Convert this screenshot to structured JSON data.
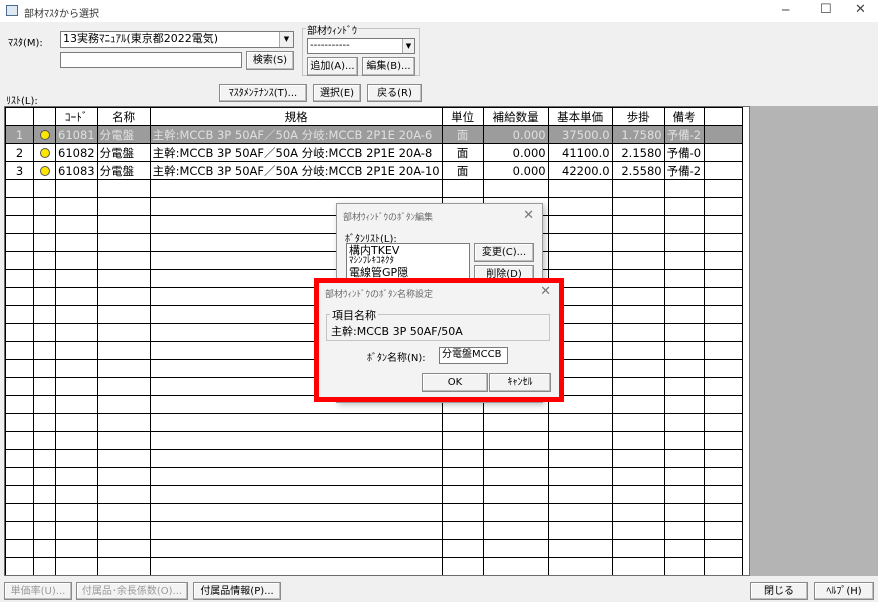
{
  "window": {
    "title": "部材ﾏｽﾀから選択",
    "app_icon": "window-icon",
    "controls": [
      "minimize-icon",
      "maximize-icon",
      "close-icon"
    ]
  },
  "master": {
    "label": "ﾏｽﾀ(M):",
    "selected": "13実務ﾏﾆｭｱﾙ(東京都2022電気)",
    "search_value": "",
    "search_button": "検索(S)"
  },
  "buhin_window": {
    "group_label": "部材ｳｨﾝﾄﾞｳ",
    "selected": "-----------",
    "add_button": "追加(A)...",
    "edit_button": "編集(B)..."
  },
  "list_label": "ﾘｽﾄ(L):",
  "toolbar": {
    "maint_button": "ﾏｽﾀﾒﾝﾃﾅﾝｽ(T)...",
    "select_button": "選択(E)",
    "back_button": "戻る(R)"
  },
  "table": {
    "headers": [
      "",
      "",
      "ｺｰﾄﾞ",
      "名称",
      "規格",
      "単位",
      "補給数量",
      "基本単価",
      "歩掛",
      "備考"
    ],
    "rows": [
      {
        "no": "1",
        "code": "61081",
        "name": "分電盤",
        "spec": "主幹:MCCB 3P 50AF／50A 分岐:MCCB 2P1E 20A-6",
        "unit": "面",
        "qty": "0.000",
        "price": "37500.0",
        "rate": "1.7580",
        "note": "予備-2"
      },
      {
        "no": "2",
        "code": "61082",
        "name": "分電盤",
        "spec": "主幹:MCCB 3P 50AF／50A 分岐:MCCB 2P1E 20A-8",
        "unit": "面",
        "qty": "0.000",
        "price": "41100.0",
        "rate": "2.1580",
        "note": "予備-0"
      },
      {
        "no": "3",
        "code": "61083",
        "name": "分電盤",
        "spec": "主幹:MCCB 3P 50AF／50A 分岐:MCCB 2P1E 20A-10",
        "unit": "面",
        "qty": "0.000",
        "price": "42200.0",
        "rate": "2.5580",
        "note": "予備-2"
      }
    ],
    "selected_row": 1,
    "status_color": "#ffe600"
  },
  "bottom": {
    "unit_rate_button": "単価率(U)...",
    "accessory_coeff_button": "付属品･余長係数(O)...",
    "accessory_info_button": "付属品情報(P)...",
    "close_button": "閉じる",
    "help_button": "ﾍﾙﾌﾟ(H)"
  },
  "edit_dialog": {
    "title": "部材ｳｨﾝﾄﾞｳのﾎﾞﾀﾝ編集",
    "list_label": "ﾎﾞﾀﾝﾘｽﾄ(L):",
    "items": [
      "構内TKEV",
      "ﾏｼﾝﾌﾚｷｺﾈｸﾀ",
      "電線管GP隠"
    ],
    "change_button": "変更(C)...",
    "delete_button": "削除(D)"
  },
  "name_dialog": {
    "title": "部材ｳｨﾝﾄﾞｳのﾎﾞﾀﾝ名称設定",
    "group_label": "項目名称",
    "item_name": "主幹:MCCB 3P 50AF/50A",
    "button_name_label": "ﾎﾞﾀﾝ名称(N):",
    "button_name_value": "分電盤MCCB",
    "ok_button": "OK",
    "cancel_button": "ｷｬﾝｾﾙ",
    "highlight_color": "#ff0000"
  }
}
